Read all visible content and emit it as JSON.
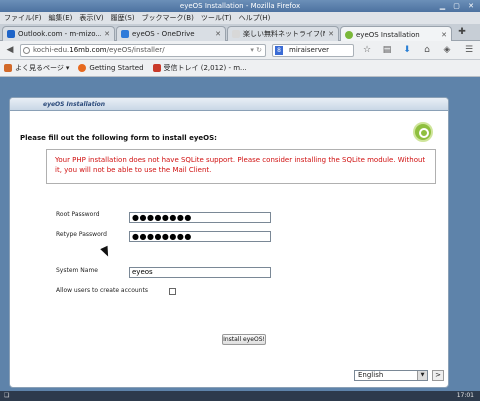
{
  "window": {
    "title": "eyeOS Installation - Mozilla Firefox",
    "controls": "▁ ▢ ✕"
  },
  "menu": [
    "ファイル(F)",
    "編集(E)",
    "表示(V)",
    "履歴(S)",
    "ブックマーク(B)",
    "ツール(T)",
    "ヘルプ(H)"
  ],
  "tabs": [
    {
      "label": "Outlook.com - m-mizo...",
      "icon_color": "#1e64c8"
    },
    {
      "label": "eyeOS - OneDrive",
      "icon_color": "#2f7bd9"
    },
    {
      "label": "楽しい無料ネットライフ(NetLi...",
      "icon_color": "#d8d8d8"
    },
    {
      "label": "eyeOS Installation",
      "icon_color": "#7ab83a"
    }
  ],
  "new_tab": "✚",
  "nav": {
    "url_prefix": "kochi-edu.",
    "url_domain": "16mb.com",
    "url_path": "/eyeOS/installer/",
    "search_engine": "8",
    "search_text": "miraiserver",
    "icons": [
      "reload-icon",
      "star-icon",
      "reading-list-icon",
      "download-icon",
      "home-icon",
      "shield-icon",
      "menu-icon"
    ]
  },
  "bookmarks": [
    {
      "label": "よく見るページ",
      "icon_color": "#d26a2a"
    },
    {
      "label": "Getting Started",
      "icon_color": "#e76a1f"
    },
    {
      "label": "受信トレイ (2,012) - m...",
      "icon_color": "#c93a2a"
    }
  ],
  "installer": {
    "header": "eyeOS Installation",
    "form_title": "Please fill out the following form to install eyeOS:",
    "error": "Your PHP installation does not have SQLite support. Please consider installing the SQLite module. Without it, you will not be able to use the Mail Client.",
    "root_password_label": "Root Password",
    "root_password_value": "●●●●●●●●",
    "retype_password_label": "Retype Password",
    "retype_password_value": "●●●●●●●●",
    "system_name_label": "System Name",
    "system_name_value": "eyeos",
    "allow_users_label": "Allow users to create accounts",
    "allow_users_checked": false,
    "install_button": "Install eyeOS!",
    "language": "English",
    "language_arrow": "▼",
    "next_button": ">"
  },
  "taskbar": {
    "left": "❏",
    "time": "17:01"
  }
}
